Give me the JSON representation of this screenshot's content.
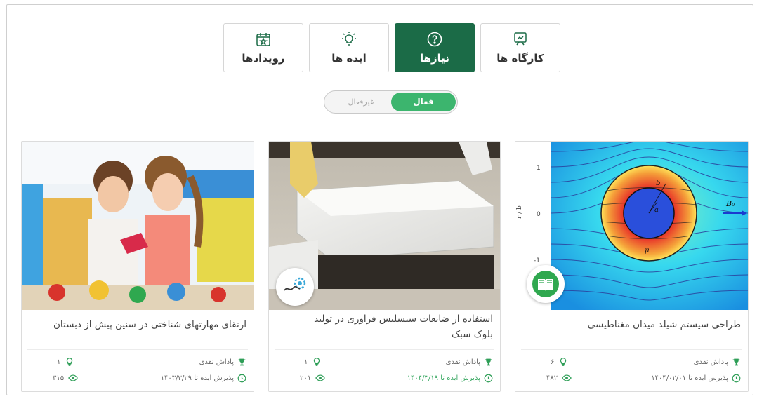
{
  "tabs": [
    {
      "label": "رویدادها",
      "icon": "calendar-star-icon",
      "active": false
    },
    {
      "label": "ایده ها",
      "icon": "lightbulb-icon",
      "active": false
    },
    {
      "label": "نیازها",
      "icon": "question-circle-icon",
      "active": true
    },
    {
      "label": "کارگاه ها",
      "icon": "workshop-icon",
      "active": false
    }
  ],
  "filter": {
    "active_label": "فعال",
    "inactive_label": "غیرفعال",
    "selected": "فعال"
  },
  "colors": {
    "brand": "#1b6b47",
    "accent": "#3cb56e",
    "text": "#444444"
  },
  "cards": [
    {
      "title": "طراحی سیستم شیلد میدان مغناطیسی",
      "reward_label": "پاداش نقدی",
      "deadline_label": "پذیرش ایده تا ۱۴۰۴/۰۲/۰۱",
      "deadline_active": false,
      "ideas_count": "۶",
      "views_count": "۴۸۲",
      "badge": "book-logo-icon",
      "figure": {
        "y_axis_label": "r / b",
        "y_ticks": [
          "1",
          "0",
          "-1"
        ],
        "label_b": "b",
        "label_a": "a",
        "label_B0": "B₀",
        "label_mu": "μ"
      }
    },
    {
      "title": "استفاده از ضایعات سیسلیس فراوری در تولید بلوک سبک",
      "reward_label": "پاداش نقدی",
      "deadline_label": "پذیرش ایده تا ۱۴۰۴/۳/۱۹",
      "deadline_active": true,
      "ideas_count": "۱",
      "views_count": "۲۰۱",
      "badge": "gear-logo-icon"
    },
    {
      "title": "ارتقای مهارتهای شناختی در سنین پیش از دبستان",
      "reward_label": "پاداش نقدی",
      "deadline_label": "پذیرش ایده تا ۱۴۰۳/۳/۲۹",
      "deadline_active": false,
      "ideas_count": "۱",
      "views_count": "۳۱۵"
    }
  ]
}
